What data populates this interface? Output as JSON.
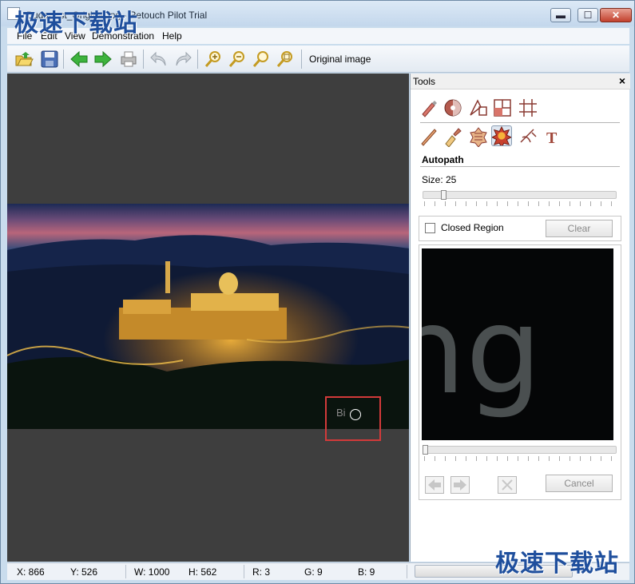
{
  "window": {
    "title": "Budapest_Original.jpg - Retouch Pilot Trial",
    "controls": {
      "minimize": "▬",
      "maximize": "☐",
      "close": "✕"
    }
  },
  "watermark": "极速下载站",
  "menu": [
    "File",
    "Edit",
    "View",
    "Demonstration",
    "Help"
  ],
  "toolbar": {
    "buttons": [
      "open-icon",
      "save-icon",
      "back-arrow-icon",
      "forward-arrow-icon",
      "print-icon",
      "undo-icon",
      "redo-icon",
      "zoom-in-icon",
      "zoom-out-icon",
      "zoom-fit-icon",
      "zoom-actual-icon"
    ],
    "original_image_label": "Original image"
  },
  "canvas": {
    "ghost_text": "Bi"
  },
  "tools_panel": {
    "title": "Tools",
    "close": "×",
    "row1_icons": [
      "retouch-brush-icon",
      "color-circle-icon",
      "transform-icon",
      "crop-icon",
      "grid-icon"
    ],
    "row2_icons": [
      "pencil-icon",
      "eraser-brush-icon",
      "pattern-icon",
      "autopath-icon",
      "lasso-icon",
      "text-tool-icon"
    ],
    "section_title": "Autopath",
    "size_label": "Size: 25",
    "size_value": 25,
    "closed_region_label": "Closed Region",
    "closed_region_checked": false,
    "clear_label": "Clear",
    "preview_text": "ng",
    "cancel_label": "Cancel"
  },
  "status": {
    "x": "X: 866",
    "y": "Y: 526",
    "w": "W: 1000",
    "h": "H: 562",
    "r": "R: 3",
    "g": "G: 9",
    "b": "B: 9"
  },
  "colors": {
    "selection": "#d23a3a",
    "canvas_bg": "#3e3e3e",
    "title_bg": "#c9dced"
  }
}
